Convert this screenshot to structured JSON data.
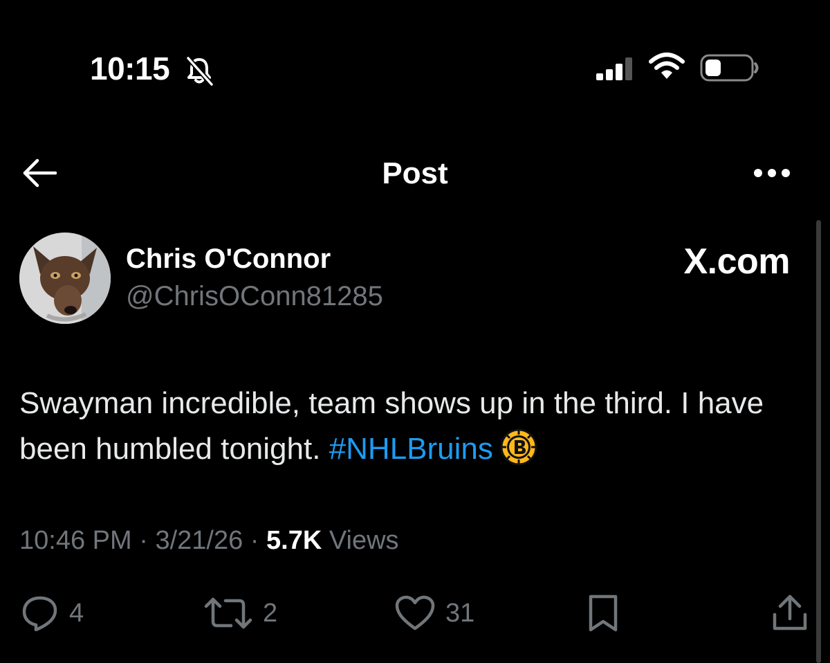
{
  "status_bar": {
    "time": "10:15",
    "icons": [
      "bell-off-icon",
      "signal-icon",
      "wifi-icon",
      "battery-icon"
    ]
  },
  "nav": {
    "title": "Post",
    "back_icon": "arrow-left-icon",
    "more_icon": "more-horizontal-icon"
  },
  "post": {
    "author_name": "Chris O'Connor",
    "author_handle": "@ChrisOConn81285",
    "watermark": "X.com",
    "body_text": "Swayman incredible, team shows up in the third. I have been humbled tonight. ",
    "hashtag": "#NHLBruins",
    "emoji_icon": "bruins-logo-icon",
    "time": "10:46 PM",
    "date": "3/21/26",
    "views_count": "5.7K",
    "views_label": "Views",
    "sep": "·"
  },
  "actions": {
    "reply_count": "4",
    "repost_count": "2",
    "like_count": "31"
  },
  "colors": {
    "background": "#000000",
    "text": "#e7e9ea",
    "muted": "#71767b",
    "link": "#1d9bf0",
    "bruins_gold": "#FFB81C"
  }
}
